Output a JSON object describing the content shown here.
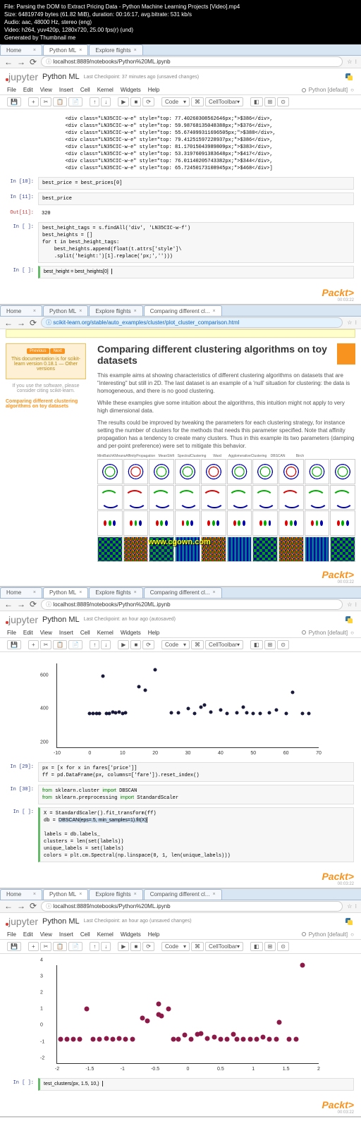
{
  "header": {
    "file": "File: Parsing the DOM to Extract Pricing Data - Python Machine Learning Projects [Video].mp4",
    "size": "Size: 64819749 bytes (61.82 MiB), duration: 00:16:17, avg.bitrate: 531 kb/s",
    "audio": "Audio: aac, 48000 Hz, stereo (eng)",
    "video": "Video: h264, yuv420p, 1280x720, 25.00 fps(r) (und)",
    "gen": "Generated by Thumbnail me"
  },
  "tabs": {
    "home": "Home",
    "pythonml": "Python ML",
    "explore": "Explore flights",
    "comparing": "Comparing different cl..."
  },
  "addr": {
    "url1": "localhost:8889/notebooks/Python%20ML.ipynb",
    "url2": "scikit-learn.org/stable/auto_examples/cluster/plot_cluster_comparison.html"
  },
  "jupyter": {
    "logo": "jupyter",
    "title": "Python ML",
    "checkpoint1": "Last Checkpoint: 37 minutes ago (unsaved changes)",
    "checkpoint2": "Last Checkpoint: an hour ago (autosaved)",
    "checkpoint3": "Last Checkpoint: an hour ago (unsaved changes)"
  },
  "menu": {
    "file": "File",
    "edit": "Edit",
    "view": "View",
    "insert": "Insert",
    "cell": "Cell",
    "kernel": "Kernel",
    "widgets": "Widgets",
    "help": "Help",
    "kernel_name": "Python [default]"
  },
  "toolbar": {
    "code": "Code",
    "celltb": "CellToolbar"
  },
  "cells1": {
    "divs": "        <div class=\"LN35CIC-w-e\" style=\"top: 77.40260308562646px;\">$386</div>,\n        <div class=\"LN35CIC-w-e\" style=\"top: 59.98768135048388px;\">$376</div>,\n        <div class=\"LN35CIC-w-e\" style=\"top: 55.674099311696505px;\">$388</div>,\n        <div class=\"LN35CIC-w-e\" style=\"top: 79.41251597228937px;\">$386</div>,\n        <div class=\"LN35CIC-w-e\" style=\"top: 81.17015043989809px;\">$383</div>,\n        <div class=\"LN35CIC-w-e\" style=\"top: 53.31976091383648px;\">$417</div>,\n        <div class=\"LN35CIC-w-e\" style=\"top: 76.01140205743382px;\">$344</div>,\n        <div class=\"LN35CIC-w-e\" style=\"top: 65.72450173108945px;\">$468</div>]",
    "in10_prompt": "In [10]:",
    "in10": "best_price = best_prices[0]",
    "in11_prompt": "In [11]:",
    "in11": "best_price",
    "out11_prompt": "Out[11]:",
    "out11": "320",
    "inblank_prompt": "In [ ]:",
    "findall": "best_height_tags = s.findAll('div', 'LN35CIC-w-f')\nbest_heights = []\nfor t in best_height_tags:\n    best_heights.append(float(t.attrs['style']\\\n    .split('height:')[1].replace('px;','')))",
    "lastcell": "best_height = best_heights[0]"
  },
  "doc": {
    "title": "Comparing different clustering algorithms on toy datasets",
    "p1": "This example aims at showing characteristics of different clustering algorithms on datasets that are \"interesting\" but still in 2D. The last dataset is an example of a 'null' situation for clustering: the data is homogeneous, and there is no good clustering.",
    "p2": "While these examples give some intuition about the algorithms, this intuition might not apply to very high dimensional data.",
    "p3": "The results could be improved by tweaking the parameters for each clustering strategy, for instance setting the number of clusters for the methods that needs this parameter specified. Note that affinity propagation has a tendency to create many clusters. Thus in this example its two parameters (damping and per-point preference) were set to mitigate this behavior.",
    "sidebar_doc": "This documentation is for scikit-learn version 0.18.1 — Other versions",
    "sidebar_cite": "If you use the software, please consider citing scikit-learn.",
    "sidebar_link": "Comparing different clustering algorithms on toy datasets",
    "watermark": "www.cgown.com",
    "cluster_labels": [
      "MiniBatchKMeans",
      "AffinityPropagation",
      "MeanShift",
      "SpectralClustering",
      "Ward",
      "AgglomerativeClustering",
      "DBSCAN",
      "Birch"
    ]
  },
  "cells3": {
    "in29_prompt": "In [29]:",
    "in29": "px = [x for x in fares['price']]\nff = pd.DataFrame(px, columns=['fare']).reset_index()",
    "in30_prompt": "In [30]:",
    "in30_l1": "from sklearn.cluster import DBSCAN",
    "in30_l2": "from sklearn.preprocessing import StandardScaler",
    "inblank_prompt": "In [ ]:",
    "dbscan_l1": "X = StandardScaler().fit_transform(ff)",
    "dbscan_l2": "db = DBSCAN(eps=.5, min_samples=1).fit(X)",
    "dbscan_rest": "\nlabels = db.labels_\nclusters = len(set(labels))\nunique_labels = set(labels)\ncolors = plt.cm.Spectral(np.linspace(0, 1, len(unique_labels)))"
  },
  "cells4": {
    "inblank_prompt": "In [ ]:",
    "testclust": "test_clusters(px, 1.5, 10,)"
  },
  "chart_data": {
    "scatter1": {
      "type": "scatter",
      "xlim": [
        -10,
        70
      ],
      "ylim": [
        200,
        700
      ],
      "yticks": [
        200,
        400,
        600
      ],
      "xticks": [
        -10,
        0,
        10,
        20,
        30,
        40,
        50,
        60,
        70
      ],
      "points": [
        [
          0,
          400
        ],
        [
          1,
          400
        ],
        [
          2,
          400
        ],
        [
          3,
          400
        ],
        [
          4,
          625
        ],
        [
          5,
          400
        ],
        [
          6,
          400
        ],
        [
          7,
          410
        ],
        [
          8,
          405
        ],
        [
          9,
          410
        ],
        [
          10,
          400
        ],
        [
          11,
          405
        ],
        [
          15,
          560
        ],
        [
          17,
          540
        ],
        [
          20,
          660
        ],
        [
          25,
          405
        ],
        [
          27,
          405
        ],
        [
          30,
          430
        ],
        [
          32,
          400
        ],
        [
          34,
          440
        ],
        [
          35,
          450
        ],
        [
          37,
          410
        ],
        [
          40,
          420
        ],
        [
          42,
          400
        ],
        [
          45,
          405
        ],
        [
          47,
          440
        ],
        [
          48,
          405
        ],
        [
          50,
          400
        ],
        [
          52,
          400
        ],
        [
          55,
          405
        ],
        [
          57,
          420
        ],
        [
          60,
          400
        ],
        [
          62,
          525
        ],
        [
          65,
          400
        ],
        [
          67,
          400
        ]
      ]
    },
    "scatter2": {
      "type": "scatter",
      "xlim": [
        -2.0,
        2.0
      ],
      "ylim": [
        -2,
        4
      ],
      "yticks": [
        -2,
        -1,
        0,
        1,
        2,
        3,
        4
      ],
      "xticks": [
        -2.0,
        -1.5,
        -1.0,
        -0.5,
        0.0,
        0.5,
        1.0,
        1.5,
        2.0
      ],
      "points": [
        [
          -1.95,
          -0.55
        ],
        [
          -1.85,
          -0.55
        ],
        [
          -1.75,
          -0.55
        ],
        [
          -1.65,
          -0.55
        ],
        [
          -1.55,
          1.3
        ],
        [
          -1.45,
          -0.55
        ],
        [
          -1.35,
          -0.55
        ],
        [
          -1.25,
          -0.5
        ],
        [
          -1.15,
          -0.52
        ],
        [
          -1.05,
          -0.5
        ],
        [
          -0.95,
          -0.55
        ],
        [
          -0.85,
          -0.52
        ],
        [
          -0.7,
          0.75
        ],
        [
          -0.62,
          0.6
        ],
        [
          -0.45,
          1.6
        ],
        [
          -0.45,
          0.95
        ],
        [
          -0.4,
          0.9
        ],
        [
          -0.3,
          1.3
        ],
        [
          -0.22,
          -0.52
        ],
        [
          -0.15,
          -0.52
        ],
        [
          -0.05,
          -0.3
        ],
        [
          0.05,
          -0.55
        ],
        [
          0.15,
          -0.22
        ],
        [
          0.2,
          -0.18
        ],
        [
          0.3,
          -0.5
        ],
        [
          0.4,
          -0.4
        ],
        [
          0.5,
          -0.55
        ],
        [
          0.6,
          -0.52
        ],
        [
          0.7,
          -0.22
        ],
        [
          0.75,
          -0.52
        ],
        [
          0.85,
          -0.55
        ],
        [
          0.95,
          -0.55
        ],
        [
          1.05,
          -0.52
        ],
        [
          1.15,
          -0.4
        ],
        [
          1.25,
          -0.54
        ],
        [
          1.35,
          -0.55
        ],
        [
          1.4,
          0.5
        ],
        [
          1.55,
          -0.55
        ],
        [
          1.65,
          -0.55
        ],
        [
          1.75,
          4.0
        ]
      ]
    }
  },
  "packt": {
    "logo": "Packt>",
    "sub": "00:03:22"
  }
}
